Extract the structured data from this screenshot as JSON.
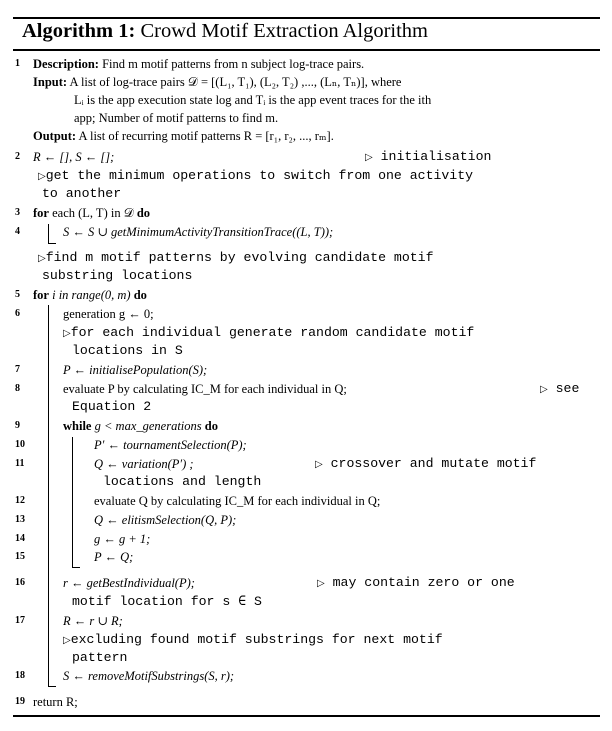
{
  "algorithm": {
    "label": "Algorithm 1:",
    "title": "Crowd Motif Extraction Algorithm"
  },
  "header": {
    "description_label": "Description:",
    "description_text": "Find m motif patterns from n subject log-trace pairs.",
    "input_label": "Input:",
    "input_line1": "A list of log-trace pairs 𝒟 = [(L₁, T₁), (L₂, T₂) ,..., (Lₙ, Tₙ)], where",
    "input_line2": "Lᵢ is the app execution state log and Tᵢ is the app event traces for the ith",
    "input_line3": "app; Number of motif patterns to find m.",
    "output_label": "Output:",
    "output_text": "A list of recurring motif patterns R = [r₁, r₂, ..., rₘ]."
  },
  "line_numbers": [
    "1",
    "2",
    "3",
    "4",
    "5",
    "6",
    "7",
    "8",
    "9",
    "10",
    "11",
    "12",
    "13",
    "14",
    "15",
    "16",
    "17",
    "18",
    "19"
  ],
  "lines": {
    "l2": "R ← [], S ← [];",
    "l2_comment": "initialisation",
    "c_a1": "get the minimum operations to switch from one activity",
    "c_a2": "to another",
    "l3_for": "for",
    "l3_mid": "each (L, T) in 𝒟",
    "l3_do": "do",
    "l4": "S ← S ∪ getMinimumActivityTransitionTrace((L, T));",
    "c_b1": "find m motif patterns by evolving candidate motif",
    "c_b2": "substring locations",
    "l5_for": "for",
    "l5_mid": "i in range(0, m)",
    "l5_do": "do",
    "l6": "generation g ← 0;",
    "c_c1": "for each individual generate random candidate motif",
    "c_c2": "locations in S",
    "l7": "P ← initialisePopulation(S);",
    "l8": "evaluate P by calculating IC_M for each individual in Q;",
    "l8_comment1": "see",
    "l8_comment2": "Equation 2",
    "l9_while": "while",
    "l9_mid": "g < max_generations",
    "l9_do": "do",
    "l10": "P′ ← tournamentSelection(P);",
    "l11": "Q ← variation(P′) ;",
    "l11_comment1": "crossover and mutate motif",
    "l11_comment2": "locations and length",
    "l12": "evaluate Q by calculating IC_M for each individual in Q;",
    "l13": "Q ← elitismSelection(Q, P);",
    "l14": "g ← g + 1;",
    "l15": "P ← Q;",
    "l16": "r ← getBestIndividual(P);",
    "l16_comment1": "may contain zero or one",
    "l16_comment2": "motif location for s ∈ S",
    "l17": "R ← r ∪ R;",
    "c_d1": "excluding found motif substrings for next motif",
    "c_d2": "pattern",
    "l18": "S ← removeMotifSubstrings(S, r);",
    "l19": "return R;"
  },
  "comment_marker": "▷"
}
